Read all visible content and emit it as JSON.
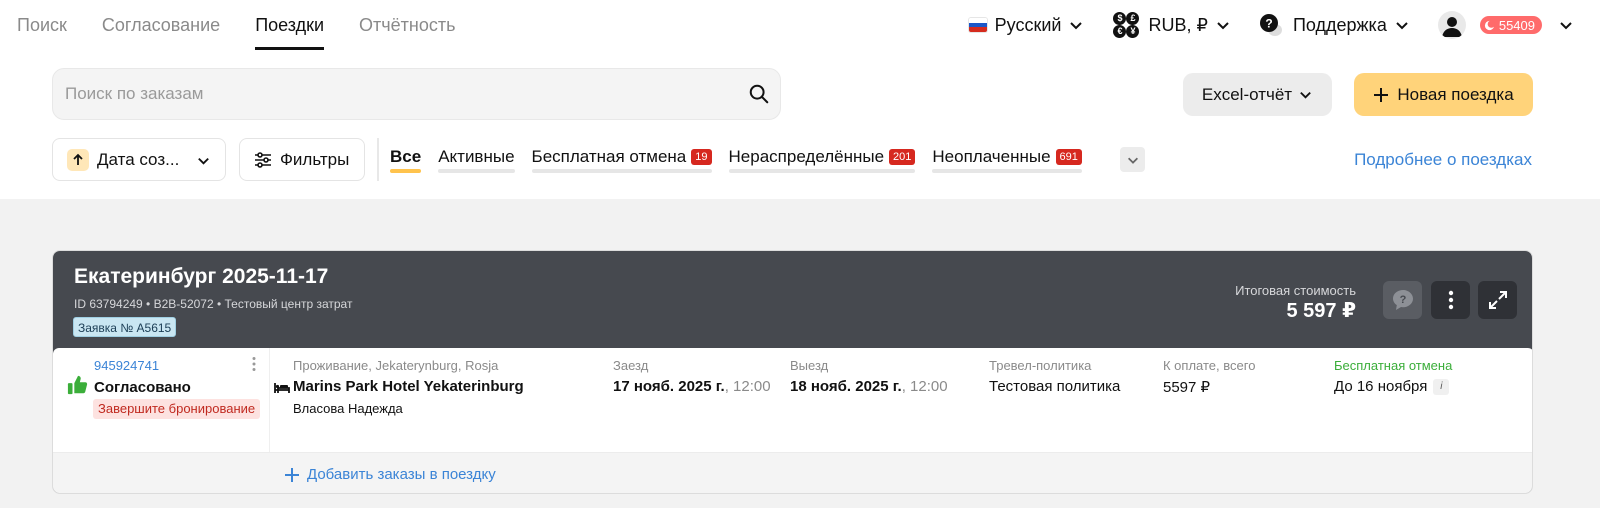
{
  "nav": {
    "tabs": [
      {
        "label": "Поиск",
        "active": false
      },
      {
        "label": "Согласование",
        "active": false
      },
      {
        "label": "Поездки",
        "active": true
      },
      {
        "label": "Отчётность",
        "active": false
      }
    ]
  },
  "topbar": {
    "language": "Русский",
    "currency": "RUB, ₽",
    "support": "Поддержка",
    "bonus_points": "55409"
  },
  "search": {
    "placeholder": "Поиск по заказам",
    "value": ""
  },
  "actions": {
    "excel_label": "Excel-отчёт",
    "new_trip_label": "Новая поездка"
  },
  "filters": {
    "sort_label": "Дата соз...",
    "filters_label": "Фильтры",
    "tabs": [
      {
        "label": "Все",
        "count": "",
        "active": true
      },
      {
        "label": "Активные",
        "count": "",
        "active": false
      },
      {
        "label": "Бесплатная отмена",
        "count": "19",
        "active": false
      },
      {
        "label": "Нераспределённые",
        "count": "201",
        "active": false
      },
      {
        "label": "Неоплаченные",
        "count": "691",
        "active": false
      }
    ],
    "details_link": "Подробнее о поездках"
  },
  "trip": {
    "title": "Екатеринбург 2025-11-17",
    "meta": "ID 63794249 • B2B-52072 • Тестовый центр затрат",
    "request_tag": "Заявка № A5615",
    "total_label": "Итоговая стоимость",
    "total_value": "5 597 ₽",
    "order": {
      "id": "945924741",
      "status": "Согласовано",
      "warning": "Завершите бронирование",
      "type_location": "Проживание, Jekaterynburg, Rosja",
      "hotel": "Marins Park Hotel Yekaterinburg",
      "guest": "Власова Надежда",
      "checkin_label": "Заезд",
      "checkin_date": "17 нояб. 2025 г.",
      "checkin_time": ", 12:00",
      "checkout_label": "Выезд",
      "checkout_date": "18 нояб. 2025 г.",
      "checkout_time": ", 12:00",
      "policy_label": "Тревел-политика",
      "policy_value": "Тестовая политика",
      "payment_label": "К оплате, всего",
      "payment_value": "5597 ₽",
      "cancel_label": "Бесплатная отмена",
      "cancel_value": "До 16 ноября",
      "info_symbol": "i"
    },
    "add_orders_label": "Добавить заказы в поездку"
  },
  "colors": {
    "accent_yellow": "#ffd37a",
    "link_blue": "#3b84d6",
    "card_header": "#46494f",
    "badge_red": "#d6281f",
    "success_green": "#3bae3a"
  }
}
